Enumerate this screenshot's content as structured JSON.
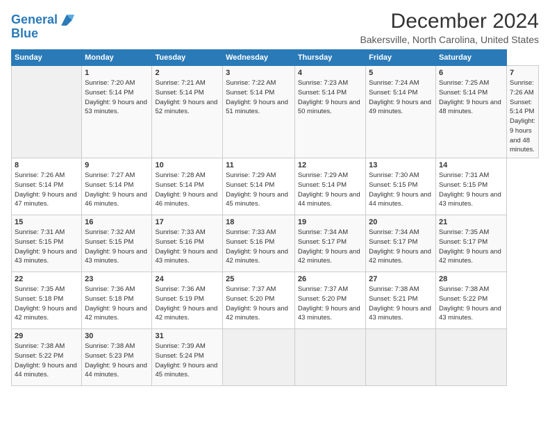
{
  "header": {
    "logo_line1": "General",
    "logo_line2": "Blue",
    "title": "December 2024",
    "subtitle": "Bakersville, North Carolina, United States"
  },
  "calendar": {
    "days_of_week": [
      "Sunday",
      "Monday",
      "Tuesday",
      "Wednesday",
      "Thursday",
      "Friday",
      "Saturday"
    ],
    "weeks": [
      [
        null,
        {
          "day": "1",
          "sunrise": "7:20 AM",
          "sunset": "5:14 PM",
          "daylight": "9 hours and 53 minutes."
        },
        {
          "day": "2",
          "sunrise": "7:21 AM",
          "sunset": "5:14 PM",
          "daylight": "9 hours and 52 minutes."
        },
        {
          "day": "3",
          "sunrise": "7:22 AM",
          "sunset": "5:14 PM",
          "daylight": "9 hours and 51 minutes."
        },
        {
          "day": "4",
          "sunrise": "7:23 AM",
          "sunset": "5:14 PM",
          "daylight": "9 hours and 50 minutes."
        },
        {
          "day": "5",
          "sunrise": "7:24 AM",
          "sunset": "5:14 PM",
          "daylight": "9 hours and 49 minutes."
        },
        {
          "day": "6",
          "sunrise": "7:25 AM",
          "sunset": "5:14 PM",
          "daylight": "9 hours and 48 minutes."
        },
        {
          "day": "7",
          "sunrise": "7:26 AM",
          "sunset": "5:14 PM",
          "daylight": "9 hours and 48 minutes."
        }
      ],
      [
        {
          "day": "8",
          "sunrise": "7:26 AM",
          "sunset": "5:14 PM",
          "daylight": "9 hours and 47 minutes."
        },
        {
          "day": "9",
          "sunrise": "7:27 AM",
          "sunset": "5:14 PM",
          "daylight": "9 hours and 46 minutes."
        },
        {
          "day": "10",
          "sunrise": "7:28 AM",
          "sunset": "5:14 PM",
          "daylight": "9 hours and 46 minutes."
        },
        {
          "day": "11",
          "sunrise": "7:29 AM",
          "sunset": "5:14 PM",
          "daylight": "9 hours and 45 minutes."
        },
        {
          "day": "12",
          "sunrise": "7:29 AM",
          "sunset": "5:14 PM",
          "daylight": "9 hours and 44 minutes."
        },
        {
          "day": "13",
          "sunrise": "7:30 AM",
          "sunset": "5:15 PM",
          "daylight": "9 hours and 44 minutes."
        },
        {
          "day": "14",
          "sunrise": "7:31 AM",
          "sunset": "5:15 PM",
          "daylight": "9 hours and 43 minutes."
        }
      ],
      [
        {
          "day": "15",
          "sunrise": "7:31 AM",
          "sunset": "5:15 PM",
          "daylight": "9 hours and 43 minutes."
        },
        {
          "day": "16",
          "sunrise": "7:32 AM",
          "sunset": "5:15 PM",
          "daylight": "9 hours and 43 minutes."
        },
        {
          "day": "17",
          "sunrise": "7:33 AM",
          "sunset": "5:16 PM",
          "daylight": "9 hours and 43 minutes."
        },
        {
          "day": "18",
          "sunrise": "7:33 AM",
          "sunset": "5:16 PM",
          "daylight": "9 hours and 42 minutes."
        },
        {
          "day": "19",
          "sunrise": "7:34 AM",
          "sunset": "5:17 PM",
          "daylight": "9 hours and 42 minutes."
        },
        {
          "day": "20",
          "sunrise": "7:34 AM",
          "sunset": "5:17 PM",
          "daylight": "9 hours and 42 minutes."
        },
        {
          "day": "21",
          "sunrise": "7:35 AM",
          "sunset": "5:17 PM",
          "daylight": "9 hours and 42 minutes."
        }
      ],
      [
        {
          "day": "22",
          "sunrise": "7:35 AM",
          "sunset": "5:18 PM",
          "daylight": "9 hours and 42 minutes."
        },
        {
          "day": "23",
          "sunrise": "7:36 AM",
          "sunset": "5:18 PM",
          "daylight": "9 hours and 42 minutes."
        },
        {
          "day": "24",
          "sunrise": "7:36 AM",
          "sunset": "5:19 PM",
          "daylight": "9 hours and 42 minutes."
        },
        {
          "day": "25",
          "sunrise": "7:37 AM",
          "sunset": "5:20 PM",
          "daylight": "9 hours and 42 minutes."
        },
        {
          "day": "26",
          "sunrise": "7:37 AM",
          "sunset": "5:20 PM",
          "daylight": "9 hours and 43 minutes."
        },
        {
          "day": "27",
          "sunrise": "7:38 AM",
          "sunset": "5:21 PM",
          "daylight": "9 hours and 43 minutes."
        },
        {
          "day": "28",
          "sunrise": "7:38 AM",
          "sunset": "5:22 PM",
          "daylight": "9 hours and 43 minutes."
        }
      ],
      [
        {
          "day": "29",
          "sunrise": "7:38 AM",
          "sunset": "5:22 PM",
          "daylight": "9 hours and 44 minutes."
        },
        {
          "day": "30",
          "sunrise": "7:38 AM",
          "sunset": "5:23 PM",
          "daylight": "9 hours and 44 minutes."
        },
        {
          "day": "31",
          "sunrise": "7:39 AM",
          "sunset": "5:24 PM",
          "daylight": "9 hours and 45 minutes."
        },
        null,
        null,
        null,
        null
      ]
    ]
  }
}
